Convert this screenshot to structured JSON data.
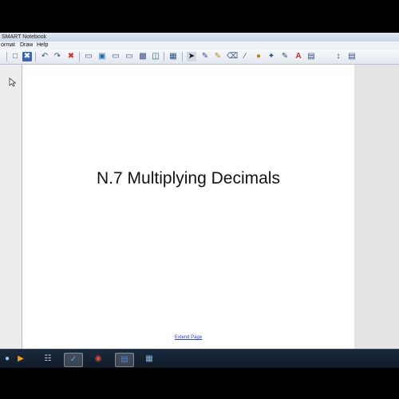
{
  "window": {
    "title": "SMART Notebook"
  },
  "menu": [
    "ormat",
    "Draw",
    "Help"
  ],
  "toolbar_icons": [
    "view-screens-icon",
    "new-page-icon",
    "delete-page-icon",
    "undo-icon",
    "redo-icon",
    "delete-icon",
    "screen-shade-icon",
    "full-screen-icon",
    "dual-display-icon",
    "show-screen-icon",
    "capture-icon",
    "document-camera-icon",
    "table-icon",
    "select-icon",
    "pen-icon",
    "creative-pen-icon",
    "eraser-icon",
    "line-icon",
    "shapes-icon",
    "magic-pen-icon",
    "fill-icon",
    "text-icon",
    "properties-icon",
    "move-toolbar-icon",
    "toolbar-options-icon"
  ],
  "page": {
    "title": "N.7 Multiplying Decimals",
    "extend_link": "Extend Page"
  },
  "taskbar_apps": [
    "start-icon",
    "media-player-icon",
    "network-icon",
    "smart-notebook-icon",
    "chrome-icon",
    "word-icon",
    "document-viewer-icon"
  ],
  "colors": {
    "workspace_bg": "#e7e7e7",
    "page_bg": "#ffffff",
    "link": "#2a3fd8",
    "taskbar_bg": "#132030",
    "toolbar_icon": "#2f4f80"
  }
}
